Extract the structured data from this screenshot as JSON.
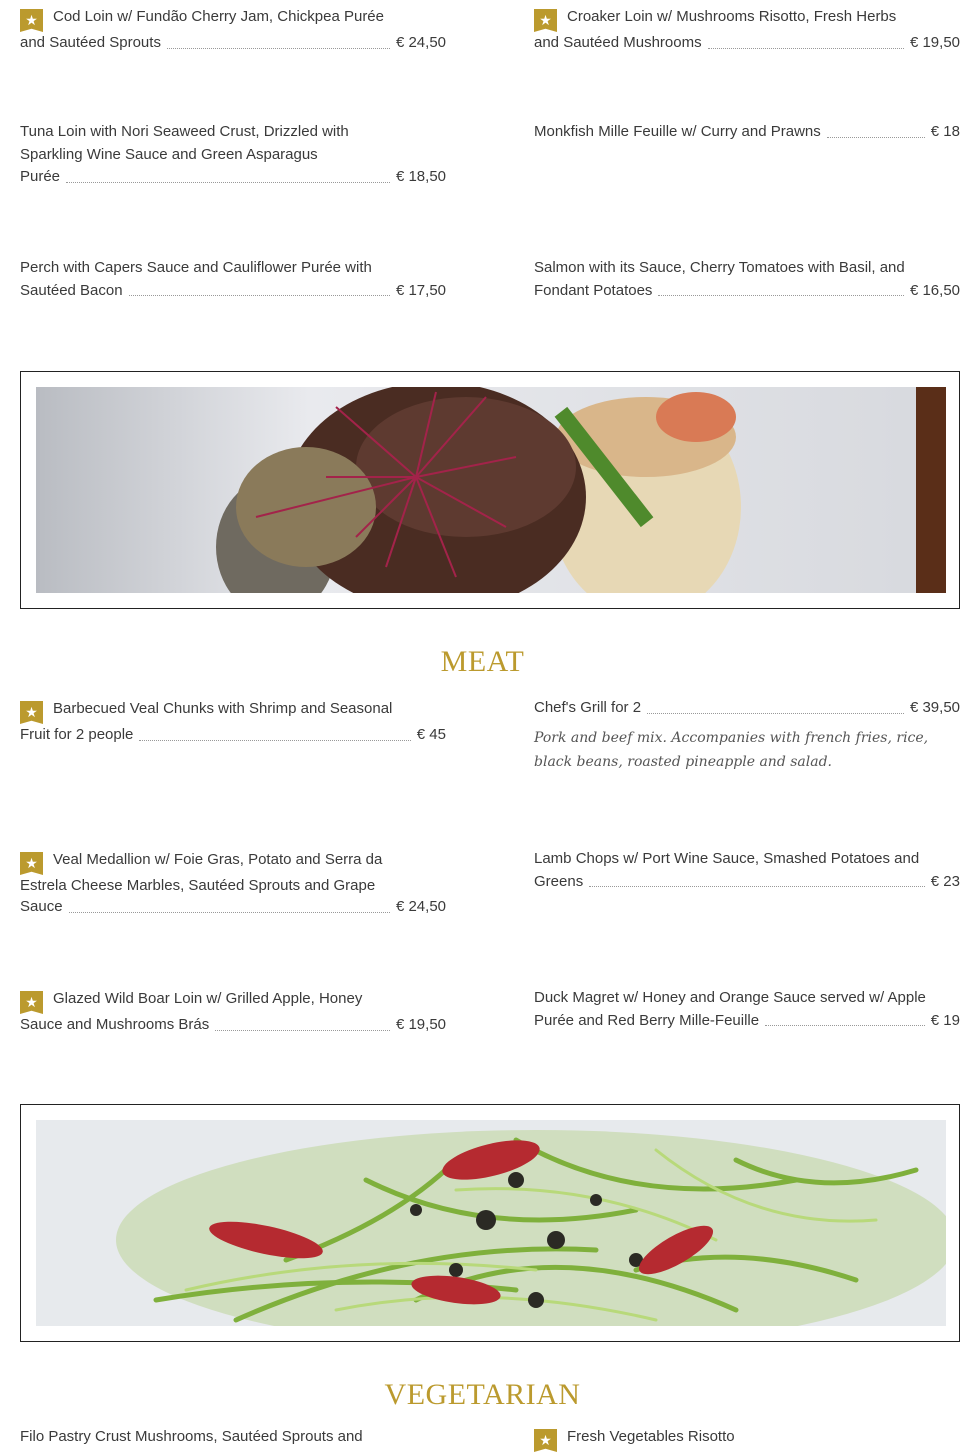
{
  "fish": {
    "items": [
      {
        "first": "Cod Loin w/ Fundão Cherry Jam, Chickpea Purée",
        "last": "and Sautéed Sprouts",
        "price": "€ 24,50",
        "star": true
      },
      {
        "first": "Croaker Loin w/ Mushrooms Risotto, Fresh Herbs",
        "last": "and Sautéed Mushrooms",
        "price": "€ 19,50",
        "star": true
      },
      {
        "first": "Tuna Loin with Nori Seaweed Crust, Drizzled with Sparkling Wine Sauce and Green Asparagus",
        "last": "Purée",
        "price": "€ 18,50",
        "star": false
      },
      {
        "first": "",
        "last": "Monkfish Mille Feuille w/ Curry and Prawns",
        "price": "€ 18",
        "star": false
      },
      {
        "first": "Perch with Capers Sauce and Cauliflower Purée with",
        "last": "Sautéed Bacon",
        "price": "€ 17,50",
        "star": false
      },
      {
        "first": "Salmon with its Sauce, Cherry Tomatoes with Basil, and",
        "last": "Fondant Potatoes",
        "price": "€ 16,50",
        "star": false
      }
    ]
  },
  "meat": {
    "title": "MEAT",
    "items": [
      {
        "first": "Barbecued Veal Chunks with Shrimp and Seasonal",
        "last": "Fruit for 2 people",
        "price": "€ 45",
        "star": true
      },
      {
        "first": "",
        "last": "Chef's Grill for 2",
        "price": "€ 39,50",
        "star": false,
        "desc": "Pork and beef mix. Accompanies with french fries, rice, black beans, roasted pineapple and salad."
      },
      {
        "first": "Veal Medallion w/ Foie Gras, Potato and Serra da Estrela Cheese Marbles, Sautéed Sprouts and Grape",
        "last": "Sauce",
        "price": "€ 24,50",
        "star": true
      },
      {
        "first": "Lamb Chops w/ Port Wine Sauce, Smashed Potatoes and",
        "last": "Greens",
        "price": "€ 23",
        "star": false
      },
      {
        "first": "Glazed Wild Boar Loin w/ Grilled Apple, Honey",
        "last": "Sauce and Mushrooms Brás",
        "price": "€ 19,50",
        "star": true
      },
      {
        "first": "Duck Magret w/ Honey and Orange Sauce served w/ Apple",
        "last": "Purée and Red Berry Mille-Feuille",
        "price": "€ 19",
        "star": false
      }
    ]
  },
  "vegetarian": {
    "title": "VEGETARIAN",
    "items": [
      {
        "first": "Filo Pastry Crust Mushrooms, Sautéed Sprouts and",
        "star": false
      },
      {
        "first": "Fresh Vegetables Risotto",
        "star": true
      }
    ]
  },
  "star_glyph": "★",
  "colors": {
    "accent": "#bb9a2e",
    "text": "#3a3a3a"
  }
}
